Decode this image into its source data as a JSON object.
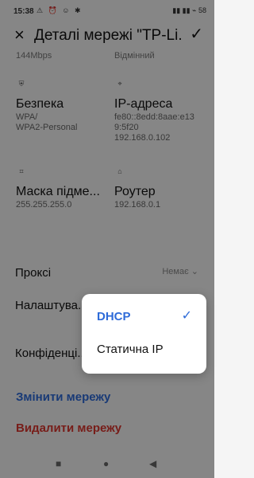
{
  "status": {
    "time": "15:38",
    "left_icons": "⚠ ⏰ ☺ ✱",
    "right_icons": "▮▮ ▮▮ ⌁ 58"
  },
  "header": {
    "title": "Деталі мережі \"TP-Li...",
    "close": "×",
    "confirm": "✓"
  },
  "top": {
    "speed": "144Mbps",
    "quality": "Відмінний"
  },
  "details": [
    {
      "label": "Безпека",
      "value": "WPA/\nWPA2-Personal",
      "icon": "shield-icon"
    },
    {
      "label": "IP-адреса",
      "value": "fe80::8edd:8aae:e13\n9:5f20\n192.168.0.102",
      "icon": "ip-icon"
    },
    {
      "label": "Маска підме...",
      "value": "255.255.255.0",
      "icon": "network-icon"
    },
    {
      "label": "Роутер",
      "value": "192.168.0.1",
      "icon": "router-icon"
    }
  ],
  "settings": {
    "proxy_label": "Проксі",
    "proxy_value": "Немає ⌄",
    "ip_settings_label": "Налаштува...",
    "privacy_label": "Конфіденці..."
  },
  "actions": {
    "change": "Змінити мережу",
    "delete": "Видалити мережу"
  },
  "popup": {
    "options": [
      {
        "label": "DHCP",
        "selected": true
      },
      {
        "label": "Статична IP",
        "selected": false
      }
    ]
  },
  "nav": {
    "recent": "■",
    "home": "●",
    "back": "◀"
  }
}
